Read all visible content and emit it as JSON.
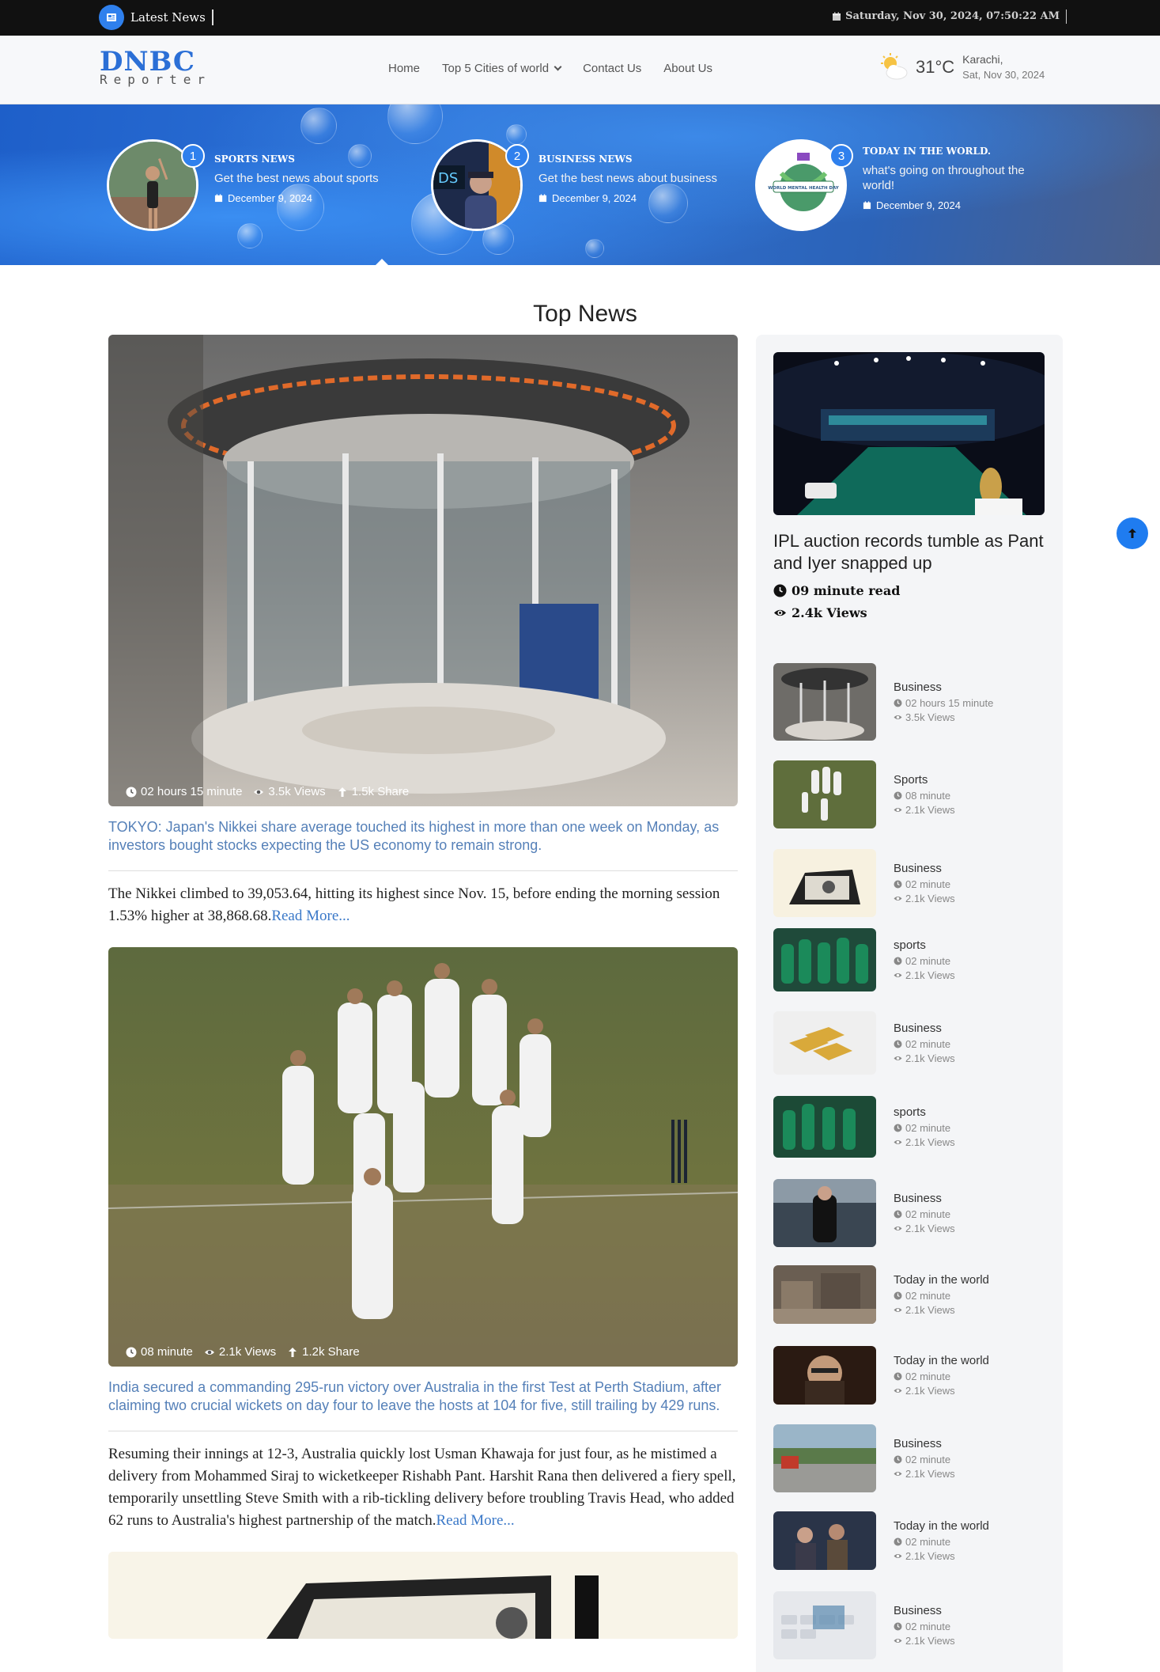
{
  "topbar": {
    "latest_label": "Latest News",
    "datetime": "Saturday, Nov 30, 2024, 07:50:22 AM"
  },
  "header": {
    "logo_main": "DNBC",
    "logo_sub": "Reporter",
    "nav": [
      "Home",
      "Top 5 Cities of world",
      "Contact Us",
      "About Us"
    ],
    "weather": {
      "temp": "31°C",
      "city": "Karachi,",
      "date": "Sat, Nov 30, 2024"
    }
  },
  "hero_cards": [
    {
      "num": "1",
      "category": "SPORTS NEWS",
      "desc": "Get the best news about sports",
      "date": "December 9, 2024"
    },
    {
      "num": "2",
      "category": "BUSINESS NEWS",
      "desc": "Get the best news about business",
      "date": "December 9, 2024"
    },
    {
      "num": "3",
      "category": "TODAY IN THE WORLD.",
      "desc": "what's going on throughout the world!",
      "date": "December 9, 2024",
      "badge_text": "WORLD MENTAL HEALTH DAY"
    }
  ],
  "section_title": "Top News",
  "articles": [
    {
      "time": "02 hours 15 minute",
      "views": "3.5k Views",
      "shares": "1.5k Share",
      "headline": "TOKYO: Japan's Nikkei share average touched its highest in more than one week on Monday, as investors bought stocks expecting the US economy to remain strong.",
      "body": "The Nikkei climbed to 39,053.64, hitting its highest since Nov. 15, before ending the morning session 1.53% higher at 38,868.68.",
      "read_more": "Read More..."
    },
    {
      "time": "08 minute",
      "views": "2.1k Views",
      "shares": "1.2k Share",
      "headline": "India secured a commanding 295-run victory over Australia in the first Test at Perth Stadium, after claiming two crucial wickets on day four to leave the hosts at 104 for five, still trailing by 429 runs.",
      "body": "Resuming their innings at 12-3, Australia quickly lost Usman Khawaja for just four, as he mistimed a delivery from Mohammed Siraj to wicketkeeper Rishabh Pant. Harshit Rana then delivered a fiery spell, temporarily unsettling Steve Smith with a rib-tickling delivery before troubling Travis Head, who added 62 runs to Australia's highest partnership of the match.",
      "read_more": "Read More..."
    }
  ],
  "sidebar": {
    "featured": {
      "title": "IPL auction records tumble as Pant and Iyer snapped up",
      "read": "09 minute read",
      "views": "2.4k Views"
    },
    "items": [
      {
        "category": "Business",
        "time": "02 hours 15 minute",
        "views": "3.5k Views"
      },
      {
        "category": "Sports",
        "time": "08 minute",
        "views": "2.1k Views"
      },
      {
        "category": "Business",
        "time": "02 minute",
        "views": "2.1k Views"
      },
      {
        "category": "sports",
        "time": "02 minute",
        "views": "2.1k Views"
      },
      {
        "category": "Business",
        "time": "02 minute",
        "views": "2.1k Views"
      },
      {
        "category": "sports",
        "time": "02 minute",
        "views": "2.1k Views"
      },
      {
        "category": "Business",
        "time": "02 minute",
        "views": "2.1k Views"
      },
      {
        "category": "Today in the world",
        "time": "02 minute",
        "views": "2.1k Views"
      },
      {
        "category": "Today in the world",
        "time": "02 minute",
        "views": "2.1k Views"
      },
      {
        "category": "Business",
        "time": "02 minute",
        "views": "2.1k Views"
      },
      {
        "category": "Today in the world",
        "time": "02 minute",
        "views": "2.1k Views"
      },
      {
        "category": "Business",
        "time": "02 minute",
        "views": "2.1k Views"
      }
    ]
  },
  "colors": {
    "accent": "#2f80ed",
    "topbar": "#111111",
    "headline": "#5580b8",
    "link": "#3a78c8"
  },
  "icons": {
    "latest": "newspaper-icon",
    "date": "calendar-icon",
    "weather": "sun-cloud-icon",
    "time": "clock-icon",
    "views": "eye-icon",
    "share": "arrow-up-icon",
    "to_top": "arrow-up-icon"
  }
}
